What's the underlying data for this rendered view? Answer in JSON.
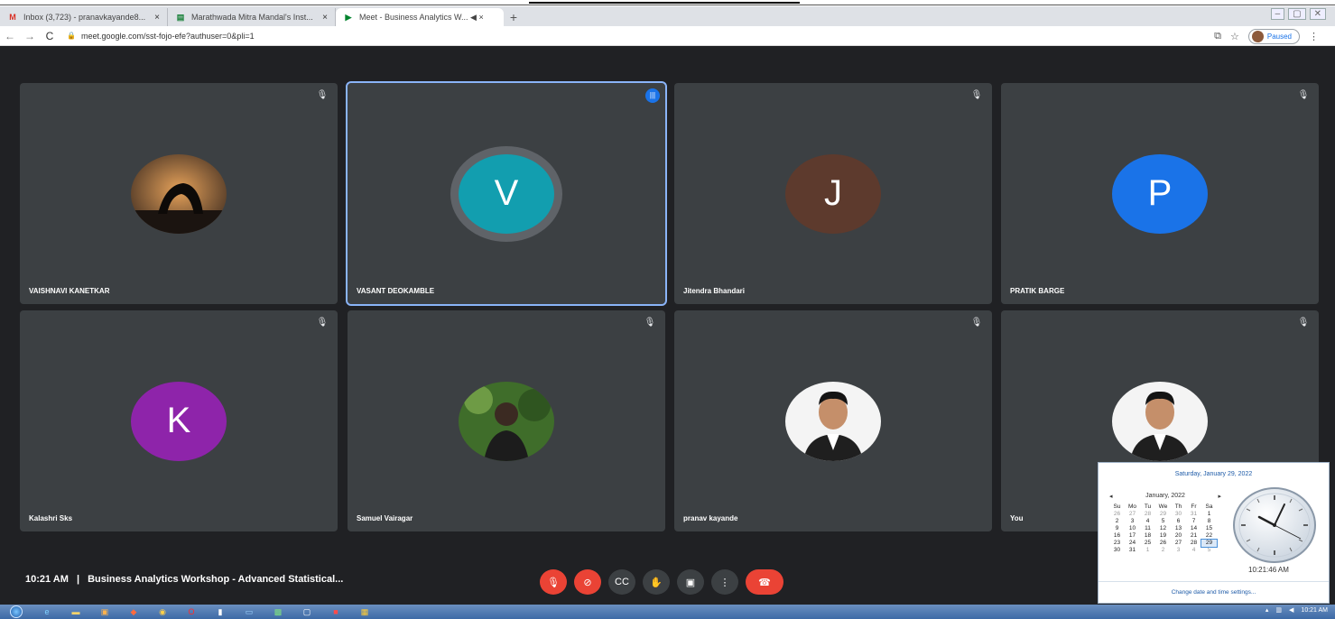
{
  "browser": {
    "tabs": [
      {
        "title": "Inbox (3,723) - pranavkayande8...",
        "icon": "gmail-icon",
        "icon_glyph": "M",
        "icon_color": "#d93025",
        "active": false
      },
      {
        "title": "Marathwada Mitra Mandal's Inst...",
        "icon": "classroom-icon",
        "icon_glyph": "▤",
        "icon_color": "#188038",
        "active": false
      },
      {
        "title": "Meet - Business Analytics W... ◀ ×",
        "icon": "meet-icon",
        "icon_glyph": "▶",
        "icon_color": "#00832d",
        "active": true
      }
    ],
    "new_tab": "+",
    "url": "meet.google.com/sst-fojo-efe?authuser=0&pli=1",
    "profile_status": "Paused"
  },
  "meet": {
    "participants": [
      {
        "name": "VAISHNAVI KANETKAR",
        "type": "photo",
        "photo": "silhouette",
        "initial": "",
        "color": "#6b4a2b"
      },
      {
        "name": "VASANT DEOKAMBLE",
        "type": "initial",
        "initial": "V",
        "color": "#129eaf",
        "speaking": true
      },
      {
        "name": "Jitendra Bhandari",
        "type": "initial",
        "initial": "J",
        "color": "#5d3a2d"
      },
      {
        "name": "PRATIK BARGE",
        "type": "initial",
        "initial": "P",
        "color": "#1a73e8"
      },
      {
        "name": "Kalashri Sks",
        "type": "initial",
        "initial": "K",
        "color": "#8e24aa"
      },
      {
        "name": "Samuel Vairagar",
        "type": "photo",
        "photo": "green",
        "initial": "",
        "color": "#2d5a1f"
      },
      {
        "name": "pranav kayande",
        "type": "photo",
        "photo": "suit",
        "initial": "",
        "color": "#f3f3f3"
      },
      {
        "name": "You",
        "type": "photo",
        "photo": "suit",
        "initial": "",
        "color": "#f3f3f3"
      }
    ],
    "meeting_time": "10:21 AM",
    "separator": "|",
    "meeting_title": "Business Analytics Workshop - Advanced Statistical...",
    "controls": [
      {
        "name": "mic-off-button",
        "glyph": "🎙",
        "color": "#ea4335"
      },
      {
        "name": "camera-off-button",
        "glyph": "⊘",
        "color": "#ea4335"
      },
      {
        "name": "captions-button",
        "glyph": "CC",
        "color": "#3c4043"
      },
      {
        "name": "raise-hand-button",
        "glyph": "✋",
        "color": "#3c4043"
      },
      {
        "name": "present-button",
        "glyph": "▣",
        "color": "#3c4043"
      },
      {
        "name": "more-options-button",
        "glyph": "⋮",
        "color": "#3c4043"
      },
      {
        "name": "end-call-button",
        "glyph": "☎",
        "color": "#ea4335"
      }
    ]
  },
  "calendar": {
    "header": "Saturday, January 29, 2022",
    "month": "January, 2022",
    "prev": "◂",
    "next": "▸",
    "weekdays": [
      "Su",
      "Mo",
      "Tu",
      "We",
      "Th",
      "Fr",
      "Sa"
    ],
    "weeks": [
      [
        "26",
        "27",
        "28",
        "29",
        "30",
        "31",
        "1"
      ],
      [
        "2",
        "3",
        "4",
        "5",
        "6",
        "7",
        "8"
      ],
      [
        "9",
        "10",
        "11",
        "12",
        "13",
        "14",
        "15"
      ],
      [
        "16",
        "17",
        "18",
        "19",
        "20",
        "21",
        "22"
      ],
      [
        "23",
        "24",
        "25",
        "26",
        "27",
        "28",
        "29"
      ],
      [
        "30",
        "31",
        "1",
        "2",
        "3",
        "4",
        "5"
      ]
    ],
    "selected": "29",
    "time": "10:21:46 AM",
    "link": "Change date and time settings..."
  },
  "taskbar": {
    "clock": "10:21 AM"
  }
}
